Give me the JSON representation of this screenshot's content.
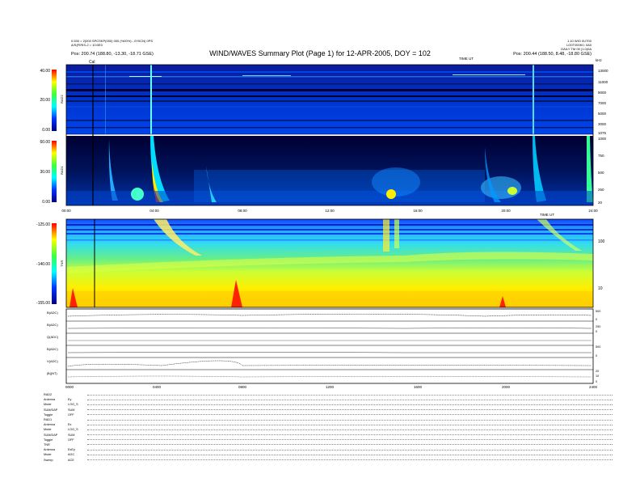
{
  "header": {
    "title": "WIND/WAVES Summary Plot (Page 1) for 12-APR-2005, DOY = 102",
    "left_lines": [
      "0.530 = 2(000 SPCSKP(000) 000 (%00%) - 0Y0CN) 0PS",
      "A/S(FIRIS-2 = 10:0E0"
    ],
    "right_lines": [
      "1.10 WIO 0UT00",
      "LO0T000K0: 0A0",
      "DAILY TM 09 (1.0)0A"
    ],
    "pos_left": "Pos: 200.74 (188.80, -13.30, -18.71 GSE)",
    "pos_right": "Pos: 200.44 (188.50, 8.48, -18.80 GSE)"
  },
  "chart_data": [
    {
      "type": "heatmap",
      "name": "RAD2",
      "xlabel": "",
      "ylabel": "RAD2",
      "colorbar_ticks": [
        "40.00",
        "20.00",
        "0.00"
      ],
      "right_ticks": [
        "13000",
        "11000",
        "9000",
        "7000",
        "5000",
        "3000",
        "1075"
      ],
      "right_unit": "kHz"
    },
    {
      "type": "heatmap",
      "name": "RAD1",
      "ylabel": "RAD1",
      "colorbar_ticks": [
        "60.00",
        "30.00",
        "0.00"
      ],
      "right_ticks": [
        "1000",
        "750",
        "500",
        "250",
        "20"
      ],
      "marker_label": "Cal"
    },
    {
      "type": "heatmap",
      "name": "TNR",
      "ylabel": "TNR",
      "colorbar_ticks": [
        "-125.00",
        "-140.00",
        "-155.00"
      ],
      "right_ticks": [
        "100",
        "10"
      ]
    },
    {
      "type": "line",
      "name": "panels",
      "series": [
        {
          "name": "B(ADC)"
        },
        {
          "name": "B(ADC)"
        },
        {
          "name": "Q(ADC)"
        },
        {
          "name": "B(ADC)"
        },
        {
          "name": "V(ADC)"
        },
        {
          "name": "|B|(NT)"
        }
      ],
      "right_ticks": [
        "500",
        "0",
        "250",
        "0",
        "500",
        "0",
        "20",
        "10",
        "0"
      ]
    }
  ],
  "xaxis": {
    "ticks": [
      "00:00",
      "04:00",
      "08:00",
      "12:00",
      "16:00",
      "20:00",
      "24:00"
    ],
    "ticks2": [
      "0000",
      "0400",
      "0800",
      "1200",
      "1600",
      "2000",
      "2400"
    ],
    "unit_top": "TIME UT"
  },
  "bottom": {
    "rows": [
      [
        "RAD2",
        ""
      ],
      [
        "Antenna",
        "Ey"
      ],
      [
        "Mode",
        "LOG_S"
      ],
      [
        "SUM/DAP",
        "SUM"
      ],
      [
        "Toggle",
        "OFF"
      ],
      [
        "RAD1",
        ""
      ],
      [
        "Antenna",
        "Ex"
      ],
      [
        "Mode",
        "LOG_S"
      ],
      [
        "SUM/DAP",
        "SUM"
      ],
      [
        "Toggle",
        "OFF"
      ],
      [
        "TNR",
        ""
      ],
      [
        "Antenna",
        "ExEy"
      ],
      [
        "Mode",
        "AGC"
      ],
      [
        "Sweep",
        "ACE"
      ]
    ]
  },
  "colors": {
    "cold": "#000080",
    "blue": "#0033ff",
    "cyan": "#00ffff",
    "green": "#40ff40",
    "yellow": "#ffff00",
    "red": "#ff0000"
  }
}
